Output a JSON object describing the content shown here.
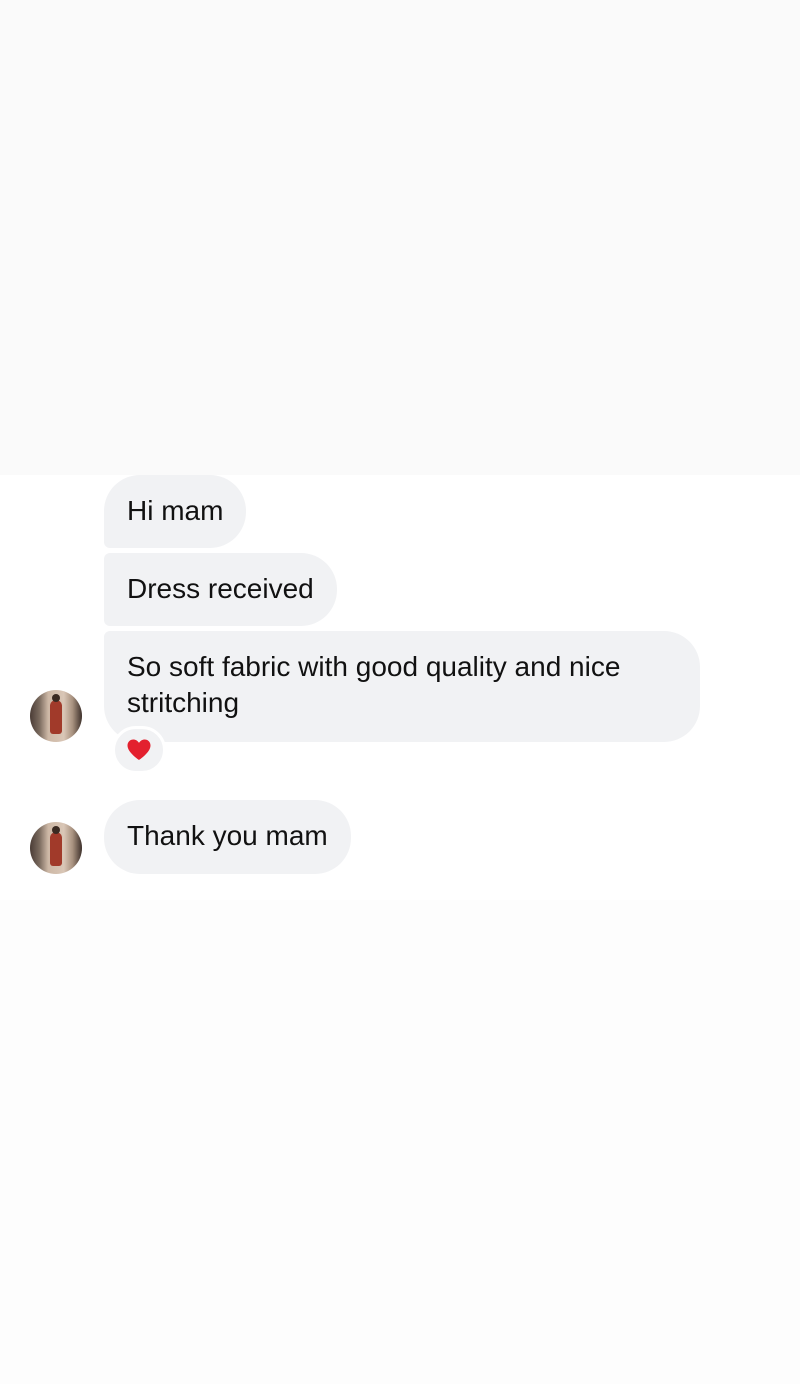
{
  "conversation": {
    "messages": [
      {
        "text": "Hi mam"
      },
      {
        "text": "Dress received"
      },
      {
        "text": "So soft fabric with good quality and nice stritching",
        "reaction": "heart-icon"
      },
      {
        "text": "Thank you mam"
      }
    ]
  },
  "colors": {
    "bubble_background": "#f1f2f4",
    "reaction_heart": "#e3202e"
  }
}
